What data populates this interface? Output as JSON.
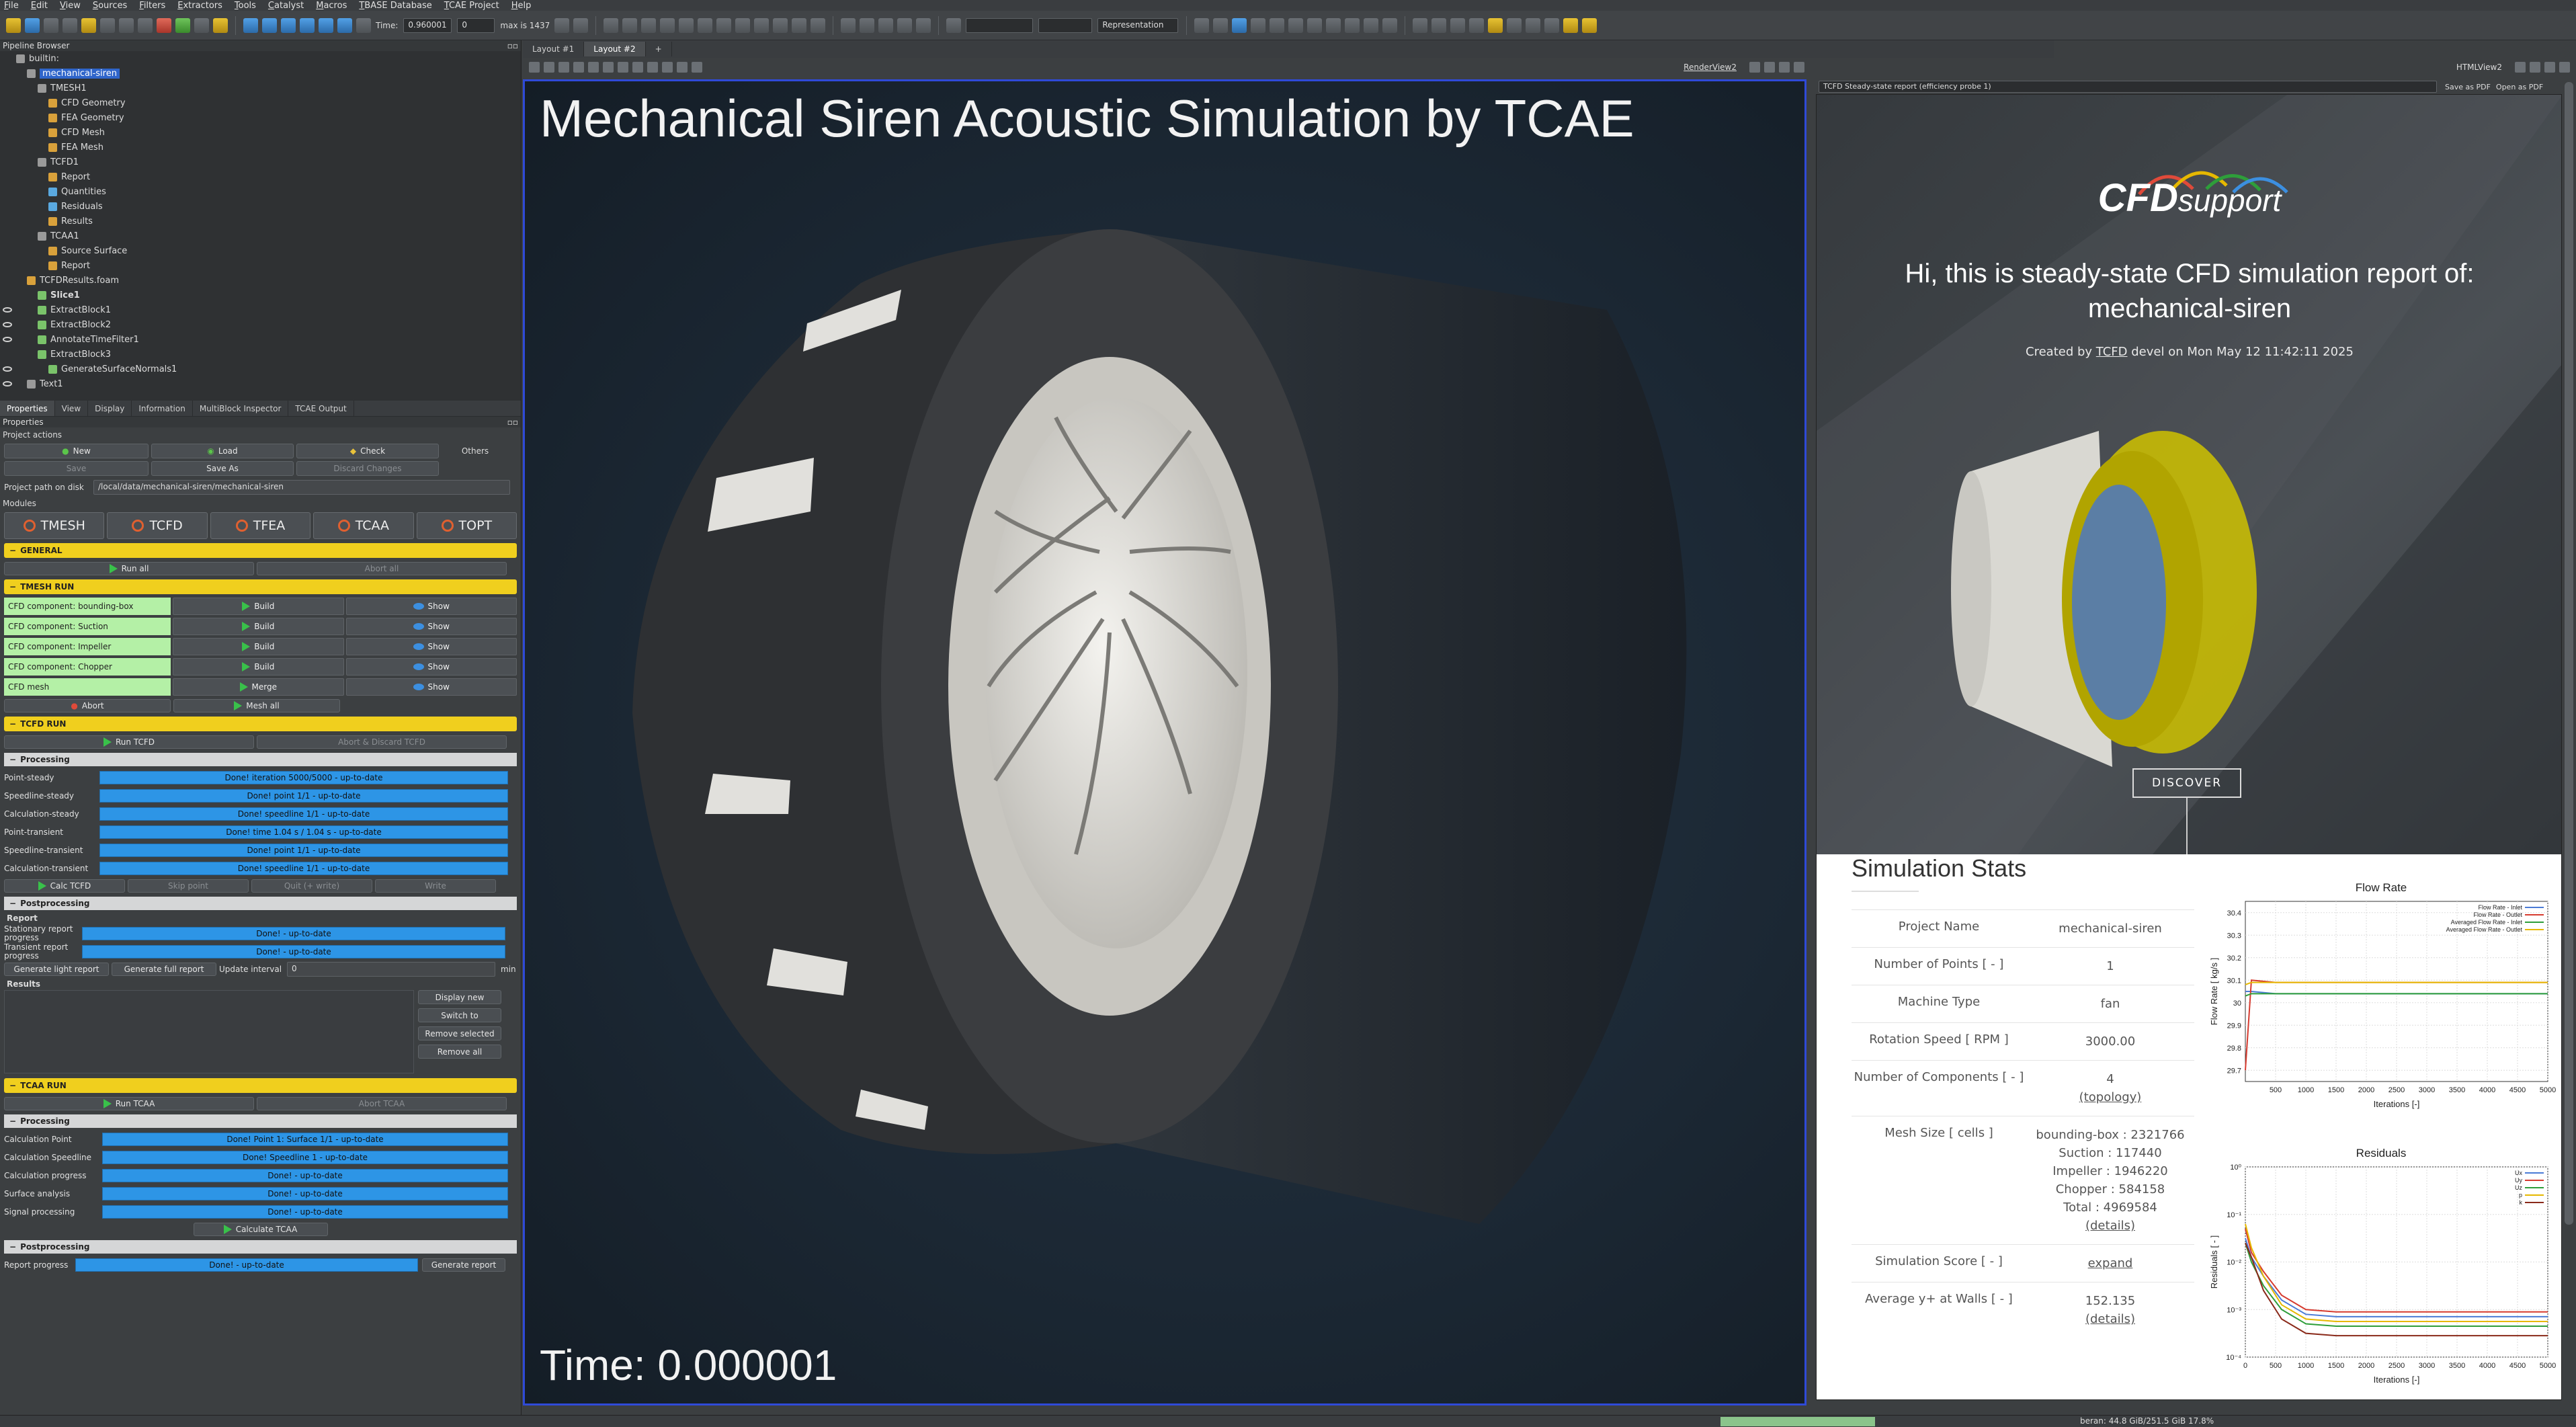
{
  "menu": [
    "File",
    "Edit",
    "View",
    "Sources",
    "Filters",
    "Extractors",
    "Tools",
    "Catalyst",
    "Macros",
    "TBASE Database",
    "TCAE Project",
    "Help"
  ],
  "toolbar": {
    "time_label": "Time:",
    "time_value": "0.960001",
    "step_value": "0",
    "max_label": "max is 1437",
    "representation": "Representation"
  },
  "pipeline": {
    "title": "Pipeline Browser",
    "items": [
      {
        "label": "builtin:",
        "indent": 0,
        "icon": "server",
        "eye": false
      },
      {
        "label": "mechanical-siren",
        "indent": 1,
        "icon": "project",
        "eye": false,
        "selected": true
      },
      {
        "label": "TMESH1",
        "indent": 2,
        "icon": "module",
        "eye": false
      },
      {
        "label": "CFD Geometry",
        "indent": 3,
        "icon": "folder",
        "eye": false
      },
      {
        "label": "FEA Geometry",
        "indent": 3,
        "icon": "folder",
        "eye": false
      },
      {
        "label": "CFD Mesh",
        "indent": 3,
        "icon": "folder",
        "eye": false
      },
      {
        "label": "FEA Mesh",
        "indent": 3,
        "icon": "folder",
        "eye": false
      },
      {
        "label": "TCFD1",
        "indent": 2,
        "icon": "module",
        "eye": false
      },
      {
        "label": "Report",
        "indent": 3,
        "icon": "folder",
        "eye": false
      },
      {
        "label": "Quantities",
        "indent": 3,
        "icon": "chart",
        "eye": false
      },
      {
        "label": "Residuals",
        "indent": 3,
        "icon": "chart",
        "eye": false
      },
      {
        "label": "Results",
        "indent": 3,
        "icon": "folder",
        "eye": false
      },
      {
        "label": "TCAA1",
        "indent": 2,
        "icon": "module",
        "eye": false
      },
      {
        "label": "Source Surface",
        "indent": 3,
        "icon": "folder",
        "eye": false
      },
      {
        "label": "Report",
        "indent": 3,
        "icon": "folder",
        "eye": false
      },
      {
        "label": "TCFDResults.foam",
        "indent": 1,
        "icon": "folder",
        "eye": false
      },
      {
        "label": "Slice1",
        "indent": 2,
        "icon": "filter",
        "eye": false,
        "bold": true
      },
      {
        "label": "ExtractBlock1",
        "indent": 2,
        "icon": "filter",
        "eye": true
      },
      {
        "label": "ExtractBlock2",
        "indent": 2,
        "icon": "filter",
        "eye": true
      },
      {
        "label": "AnnotateTimeFilter1",
        "indent": 2,
        "icon": "filter",
        "eye": true
      },
      {
        "label": "ExtractBlock3",
        "indent": 2,
        "icon": "filter",
        "eye": false
      },
      {
        "label": "GenerateSurfaceNormals1",
        "indent": 3,
        "icon": "filter",
        "eye": true
      },
      {
        "label": "Text1",
        "indent": 1,
        "icon": "text",
        "eye": true
      }
    ]
  },
  "prop_tabs": [
    "Properties",
    "View",
    "Display",
    "Information",
    "MultiBlock Inspector",
    "TCAE Output"
  ],
  "properties": {
    "title": "Properties",
    "project_actions": "Project actions",
    "new": "New",
    "load": "Load",
    "check": "Check",
    "save": "Save",
    "save_as": "Save As",
    "discard": "Discard Changes",
    "others": "Others",
    "path_label": "Project path on disk",
    "path_value": "/local/data/mechanical-siren/mechanical-siren",
    "modules_label": "Modules",
    "modules": [
      "TMESH",
      "TCFD",
      "TFEA",
      "TCAA",
      "TOPT"
    ]
  },
  "general": {
    "title": "GENERAL",
    "run_all": "Run all",
    "abort_all": "Abort all"
  },
  "tmesh": {
    "title": "TMESH RUN",
    "rows": [
      {
        "label": "CFD component: bounding-box",
        "build": "Build",
        "show": "Show"
      },
      {
        "label": "CFD component: Suction",
        "build": "Build",
        "show": "Show"
      },
      {
        "label": "CFD component: Impeller",
        "build": "Build",
        "show": "Show"
      },
      {
        "label": "CFD component: Chopper",
        "build": "Build",
        "show": "Show"
      },
      {
        "label": "CFD mesh",
        "build": "Merge",
        "show": "Show"
      }
    ],
    "abort": "Abort",
    "mesh_all": "Mesh all"
  },
  "tcfd": {
    "title": "TCFD RUN",
    "run": "Run TCFD",
    "abort": "Abort & Discard TCFD",
    "processing": "Processing",
    "rows": [
      {
        "label": "Point-steady",
        "status": "Done! iteration 5000/5000 - up-to-date"
      },
      {
        "label": "Speedline-steady",
        "status": "Done! point 1/1 - up-to-date"
      },
      {
        "label": "Calculation-steady",
        "status": "Done! speedline 1/1 - up-to-date"
      },
      {
        "label": "Point-transient",
        "status": "Done! time 1.04 s / 1.04 s - up-to-date"
      },
      {
        "label": "Speedline-transient",
        "status": "Done! point 1/1 - up-to-date"
      },
      {
        "label": "Calculation-transient",
        "status": "Done! speedline 1/1 - up-to-date"
      }
    ],
    "calc": "Calc TCFD",
    "skip": "Skip point",
    "quit": "Quit (+ write)",
    "write": "Write",
    "postprocessing": "Postprocessing",
    "report": "Report",
    "stationary_label": "Stationary report progress",
    "stationary_status": "Done! - up-to-date",
    "transient_label": "Transient report progress",
    "transient_status": "Done! - up-to-date",
    "light_report": "Generate light report",
    "full_report": "Generate full report",
    "update_label": "Update interval",
    "update_value": "0",
    "update_unit": "min",
    "results": "Results",
    "display_new": "Display new",
    "switch_to": "Switch to",
    "remove_selected": "Remove selected",
    "remove_all": "Remove all"
  },
  "tcaa": {
    "title": "TCAA RUN",
    "run": "Run TCAA",
    "abort": "Abort TCAA",
    "processing": "Processing",
    "rows": [
      {
        "label": "Calculation Point",
        "status": "Done! Point 1: Surface 1/1 - up-to-date"
      },
      {
        "label": "Calculation Speedline",
        "status": "Done! Speedline 1 - up-to-date"
      },
      {
        "label": "Calculation progress",
        "status": "Done! - up-to-date"
      },
      {
        "label": "Surface analysis",
        "status": "Done! - up-to-date"
      },
      {
        "label": "Signal processing",
        "status": "Done! - up-to-date"
      }
    ],
    "calculate": "Calculate TCAA",
    "postprocessing": "Postprocessing",
    "report_label": "Report progress",
    "report_status": "Done! - up-to-date",
    "generate": "Generate report"
  },
  "layout_tabs": [
    "Layout #1",
    "Layout #2"
  ],
  "renderview": {
    "name": "RenderView2",
    "title": "Mechanical Siren Acoustic Simulation by TCAE",
    "time": "Time: 0.000001"
  },
  "htmlview": {
    "name": "HTMLView2",
    "dropdown": "TCFD Steady-state report (efficiency probe 1)",
    "save_pdf": "Save as PDF",
    "open_pdf": "Open as PDF"
  },
  "report": {
    "logo_main": "CFD",
    "logo_sub": "support",
    "hi": "Hi, this is steady-state CFD simulation report of:",
    "project": "mechanical-siren",
    "created_prefix": "Created by ",
    "created_user": "TCFD",
    "created_suffix": " devel on Mon May 12 11:42:11 2025",
    "discover": "DISCOVER",
    "stats_title": "Simulation Stats",
    "stats": [
      {
        "key": "Project Name",
        "value": "mechanical-siren"
      },
      {
        "key": "Number of Points [ - ]",
        "value": "1"
      },
      {
        "key": "Machine Type",
        "value": "fan"
      },
      {
        "key": "Rotation Speed [ RPM ]",
        "value": "3000.00"
      },
      {
        "key": "Number of Components [ - ]",
        "value": "4",
        "link": "(topology)"
      },
      {
        "key": "Mesh Size [ cells ]",
        "value": "bounding-box : 2321766",
        "extra": [
          "Suction : 117440",
          "Impeller : 1946220",
          "Chopper : 584158",
          "Total : 4969584"
        ],
        "link": "(details)"
      },
      {
        "key": "Simulation Score [ - ]",
        "value": "expand",
        "is_link": true
      },
      {
        "key": "Average y+ at Walls [ - ]",
        "value": "152.135",
        "link": "(details)"
      }
    ]
  },
  "status": {
    "memory": "beran: 44.8 GiB/251.5 GiB 17.8%",
    "progress": 0.06
  },
  "chart_data": [
    {
      "type": "line",
      "title": "Flow Rate",
      "xlabel": "Iterations [-]",
      "ylabel": "Flow Rate [ kg/s ]",
      "xlim": [
        0,
        5000
      ],
      "ylim": [
        29.65,
        30.45
      ],
      "xticks": [
        500,
        1000,
        1500,
        2000,
        2500,
        3000,
        3500,
        4000,
        4500,
        5000
      ],
      "yticks": [
        29.7,
        29.8,
        29.9,
        30,
        30.1,
        30.2,
        30.3,
        30.4
      ],
      "legend": "top-right",
      "series": [
        {
          "name": "Flow Rate - Inlet",
          "color": "#4b7bd6",
          "x": [
            0,
            100,
            500,
            1000,
            2000,
            3000,
            4000,
            5000
          ],
          "y": [
            30.05,
            30.05,
            30.04,
            30.04,
            30.04,
            30.04,
            30.04,
            30.04
          ]
        },
        {
          "name": "Flow Rate - Outlet",
          "color": "#d63b2f",
          "x": [
            0,
            100,
            500,
            1000,
            2000,
            3000,
            4000,
            5000
          ],
          "y": [
            29.7,
            30.1,
            30.09,
            30.09,
            30.09,
            30.09,
            30.09,
            30.09
          ]
        },
        {
          "name": "Averaged Flow Rate - Inlet",
          "color": "#2e9e3a",
          "x": [
            0,
            100,
            500,
            1000,
            2000,
            3000,
            4000,
            5000
          ],
          "y": [
            30.03,
            30.04,
            30.04,
            30.04,
            30.04,
            30.04,
            30.04,
            30.04
          ]
        },
        {
          "name": "Averaged Flow Rate - Outlet",
          "color": "#e6b800",
          "x": [
            0,
            100,
            500,
            1000,
            2000,
            3000,
            4000,
            5000
          ],
          "y": [
            30.08,
            30.09,
            30.09,
            30.09,
            30.09,
            30.09,
            30.09,
            30.09
          ]
        }
      ]
    },
    {
      "type": "line",
      "title": "Residuals",
      "xlabel": "Iterations [-]",
      "ylabel": "Residuals [ - ]",
      "xlim": [
        0,
        5000
      ],
      "ylim": [
        -4,
        0
      ],
      "yscale": "log",
      "xticks": [
        0,
        500,
        1000,
        1500,
        2000,
        2500,
        3000,
        3500,
        4000,
        4500,
        5000
      ],
      "yticks": [
        -4,
        -3,
        -2,
        -1,
        0
      ],
      "legend": "top-right",
      "series": [
        {
          "name": "Ux",
          "color": "#4b7bd6",
          "x": [
            0,
            100,
            300,
            600,
            1000,
            1500,
            2000,
            3000,
            4000,
            5000
          ],
          "y": [
            -1.5,
            -1.9,
            -2.3,
            -2.8,
            -3.1,
            -3.15,
            -3.15,
            -3.15,
            -3.15,
            -3.15
          ]
        },
        {
          "name": "Uy",
          "color": "#d63b2f",
          "x": [
            0,
            100,
            300,
            600,
            1000,
            1500,
            2000,
            3000,
            4000,
            5000
          ],
          "y": [
            -1.3,
            -1.8,
            -2.2,
            -2.7,
            -3.0,
            -3.05,
            -3.05,
            -3.05,
            -3.05,
            -3.05
          ]
        },
        {
          "name": "Uz",
          "color": "#2e9e3a",
          "x": [
            0,
            100,
            300,
            600,
            1000,
            1500,
            2000,
            3000,
            4000,
            5000
          ],
          "y": [
            -1.6,
            -2.0,
            -2.5,
            -3.0,
            -3.3,
            -3.35,
            -3.35,
            -3.35,
            -3.35,
            -3.35
          ]
        },
        {
          "name": "p",
          "color": "#e6b800",
          "x": [
            0,
            100,
            300,
            600,
            1000,
            1500,
            2000,
            3000,
            4000,
            5000
          ],
          "y": [
            -1.2,
            -1.7,
            -2.3,
            -2.9,
            -3.2,
            -3.25,
            -3.25,
            -3.25,
            -3.25,
            -3.25
          ]
        },
        {
          "name": "k",
          "color": "#8a2a1a",
          "x": [
            0,
            100,
            300,
            600,
            1000,
            1500,
            2000,
            3000,
            4000,
            5000
          ],
          "y": [
            -1.6,
            -1.9,
            -2.6,
            -3.2,
            -3.5,
            -3.55,
            -3.55,
            -3.55,
            -3.55,
            -3.55
          ]
        }
      ]
    }
  ]
}
